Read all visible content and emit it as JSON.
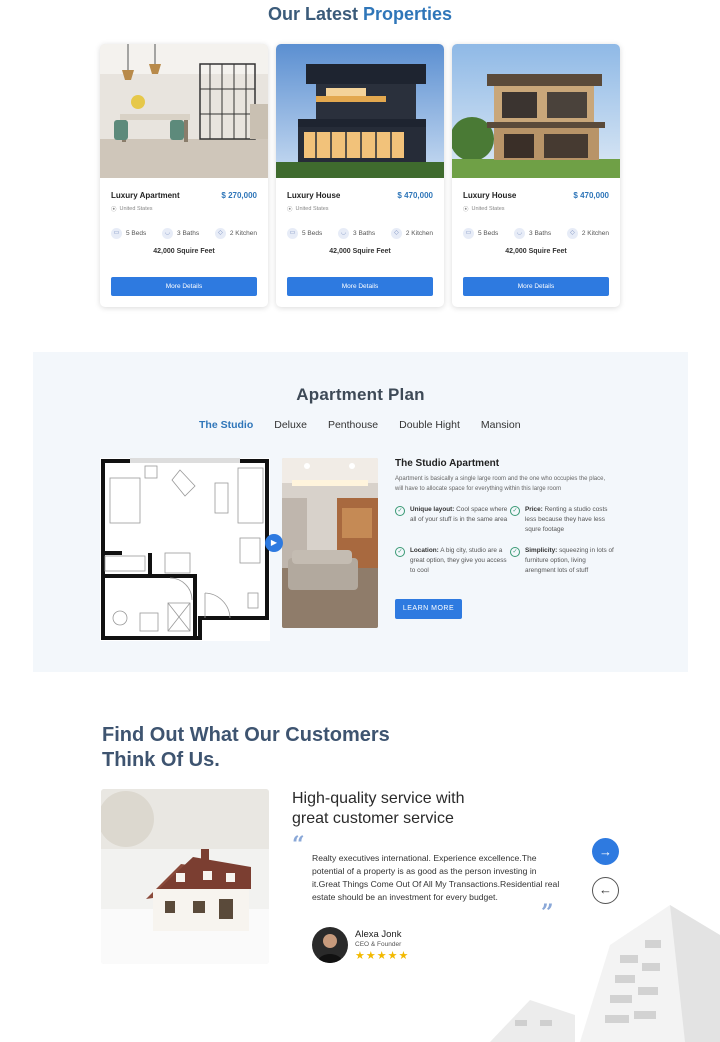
{
  "latest": {
    "title_part1": "Our Latest",
    "title_part2": "Properties",
    "cards": [
      {
        "name": "Luxury Apartment",
        "price": "$ 270,000",
        "location": "United States",
        "beds": "5 Beds",
        "baths": "3 Baths",
        "kitchen": "2 Kitchen",
        "area": "42,000 Squire Feet",
        "button": "More Details"
      },
      {
        "name": "Luxury House",
        "price": "$ 470,000",
        "location": "United States",
        "beds": "5 Beds",
        "baths": "3 Baths",
        "kitchen": "2 Kitchen",
        "area": "42,000 Squire Feet",
        "button": "More Details"
      },
      {
        "name": "Luxury House",
        "price": "$ 470,000",
        "location": "United States",
        "beds": "5 Beds",
        "baths": "3 Baths",
        "kitchen": "2 Kitchen",
        "area": "42,000 Squire Feet",
        "button": "More Details"
      }
    ]
  },
  "plan": {
    "title": "Apartment  Plan",
    "tabs": [
      "The Studio",
      "Deluxe",
      "Penthouse",
      "Double Hight",
      "Mansion"
    ],
    "active_tab": "The Studio",
    "heading": "The Studio Apartment",
    "description": "Apartment is basically a single large room and the one who occupies the place, will have to allocate space for everything within this large room",
    "points": [
      {
        "label": "Unique layout:",
        "text": "Cool space where all of your stuff is in the same area"
      },
      {
        "label": "Price:",
        "text": "Renting a studio costs less because they have less squre footage"
      },
      {
        "label": "Location:",
        "text": "A big city, studio are a great option, they give you access  to cool"
      },
      {
        "label": "Simplicity:",
        "text": "squeezing in lots of furniture option, living arengment lots of stuff"
      }
    ],
    "button": "LEARN MORE"
  },
  "testimonials": {
    "title_line1": "Find Out What Our Customers",
    "title_line2": "Think Of Us.",
    "heading_line1": "High-quality service with",
    "heading_line2": "great customer service",
    "quote": "Realty executives international. Experience excellence.The potential of a property is as good as the person investing in it.Great Things Come Out Of All My Transactions.Residential real estate should be an investment for every budget.",
    "author_name": "Alexa Jonk",
    "author_role": "CEO & Founder",
    "stars": "★★★★★",
    "rating": 5
  },
  "colors": {
    "accent": "#2e7ae0",
    "title": "#3e5470",
    "plan_bg": "#f3f7fb",
    "star": "#f2b900"
  },
  "icons": [
    "location-pin-icon",
    "bed-icon",
    "bath-icon",
    "kitchen-icon",
    "play-icon",
    "check-circle-icon",
    "quote-icon",
    "arrow-right-icon",
    "arrow-left-icon",
    "star-icon"
  ]
}
